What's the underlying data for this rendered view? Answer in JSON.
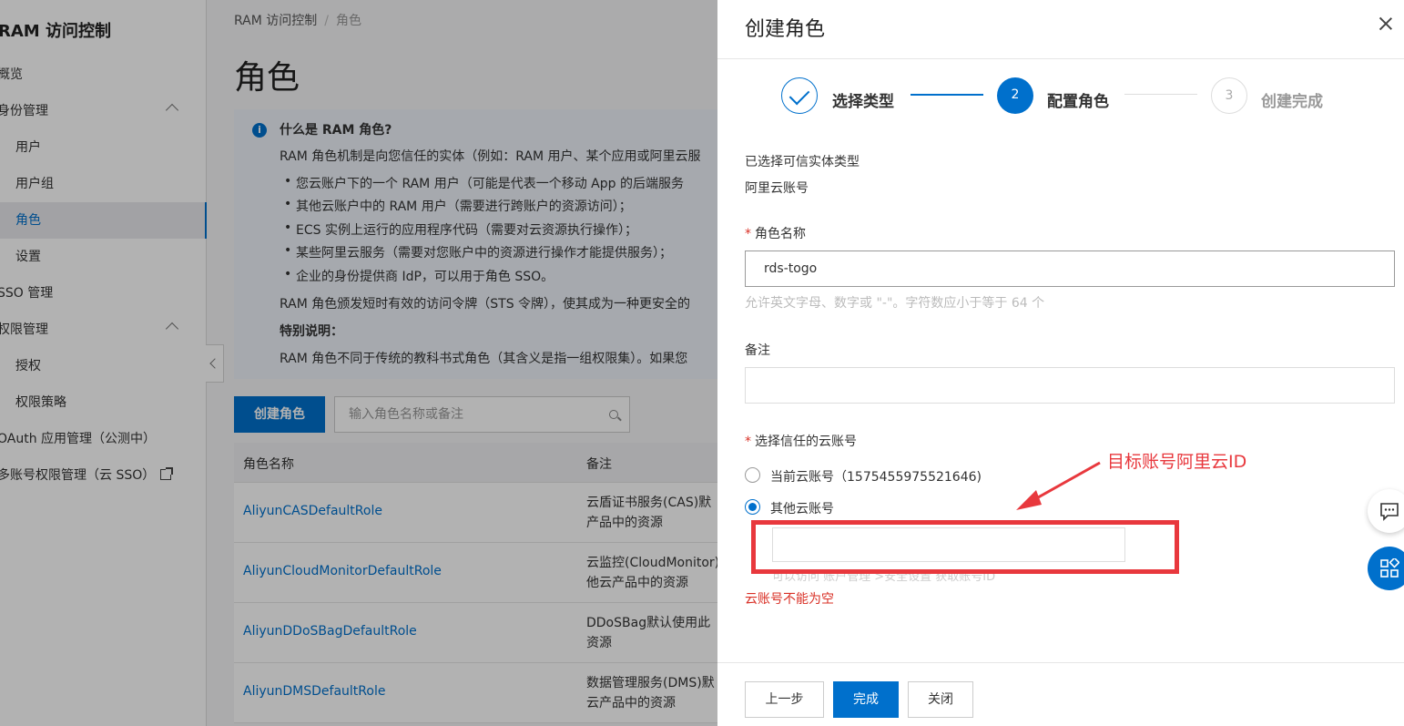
{
  "sidebar": {
    "title": "RAM 访问控制",
    "items": [
      {
        "label": "概览"
      },
      {
        "label": "身份管理"
      },
      {
        "label": "用户"
      },
      {
        "label": "用户组"
      },
      {
        "label": "角色"
      },
      {
        "label": "设置"
      },
      {
        "label": "SSO 管理"
      },
      {
        "label": "权限管理"
      },
      {
        "label": "授权"
      },
      {
        "label": "权限策略"
      },
      {
        "label": "OAuth 应用管理（公测中）"
      },
      {
        "label": "多账号权限管理（云 SSO）"
      }
    ]
  },
  "breadcrumb": {
    "root": "RAM 访问控制",
    "separator": "/",
    "current": "角色"
  },
  "page": {
    "title": "角色"
  },
  "info": {
    "heading": "什么是 RAM 角色?",
    "intro": "RAM 角色机制是向您信任的实体（例如：RAM 用户、某个应用或阿里云服",
    "bullets": [
      "您云账户下的一个 RAM 用户（可能是代表一个移动 App 的后端服务",
      "其他云账户中的 RAM 用户（需要进行跨账户的资源访问）；",
      "ECS 实例上运行的应用程序代码（需要对云资源执行操作）；",
      "某些阿里云服务（需要对您账户中的资源进行操作才能提供服务）；",
      "企业的身份提供商 IdP，可以用于角色 SSO。"
    ],
    "sts": "RAM 角色颁发短时有效的访问令牌（STS 令牌），使其成为一种更安全的",
    "special_heading": "特别说明：",
    "special": "RAM 角色不同于传统的教科书式角色（其含义是指一组权限集）。如果您"
  },
  "toolbar": {
    "create_label": "创建角色",
    "search_placeholder": "输入角色名称或备注"
  },
  "table": {
    "headers": [
      "角色名称",
      "备注"
    ],
    "rows": [
      {
        "name": "AliyunCASDefaultRole",
        "note": [
          "云盾证书服务(CAS)默",
          "产品中的资源"
        ]
      },
      {
        "name": "AliyunCloudMonitorDefaultRole",
        "note": [
          "云监控(CloudMonitor)",
          "他云产品中的资源"
        ]
      },
      {
        "name": "AliyunDDoSBagDefaultRole",
        "note": [
          "DDoSBag默认使用此",
          "资源"
        ]
      },
      {
        "name": "AliyunDMSDefaultRole",
        "note": [
          "数据管理服务(DMS)默",
          "云产品中的资源"
        ]
      }
    ]
  },
  "drawer": {
    "title": "创建角色",
    "steps": [
      {
        "label": "选择类型",
        "state": "done"
      },
      {
        "number": "2",
        "label": "配置角色",
        "state": "active"
      },
      {
        "number": "3",
        "label": "创建完成",
        "state": "todo"
      }
    ],
    "entity_type_label": "已选择可信实体类型",
    "entity_type_value": "阿里云账号",
    "role_name_label": "角色名称",
    "role_name_value": "rds-togo",
    "role_name_hint": "允许英文字母、数字或 \"-\"。字符数应小于等于 64 个",
    "remark_label": "备注",
    "remark_value": "",
    "trust_label": "选择信任的云账号",
    "radio_current": "当前云账号（1575455975521646)",
    "radio_other": "其他云账号",
    "account_value": "",
    "account_hint": "可以访问 账户管理 >安全设置 获取账号ID",
    "error": "云账号不能为空",
    "annotation": "目标账号阿里云ID",
    "buttons": {
      "prev": "上一步",
      "finish": "完成",
      "close": "关闭"
    }
  },
  "colors": {
    "primary": "#0070cc",
    "error": "#d93026",
    "annotation": "#e8383d"
  }
}
